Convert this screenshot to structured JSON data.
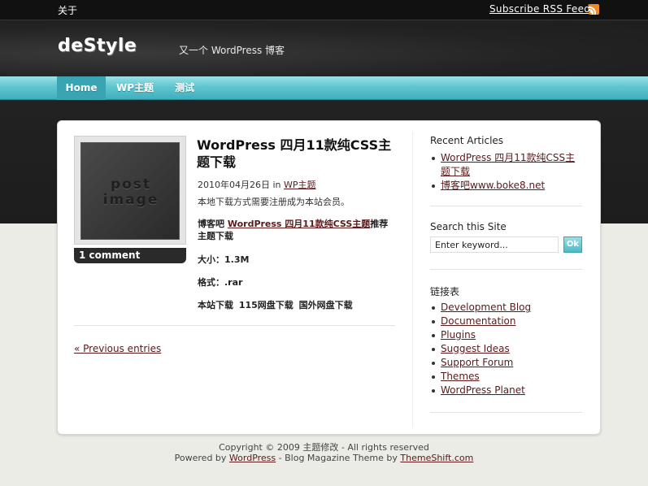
{
  "topbar": {
    "about_label": "关于",
    "rss_label": "Subscribe RSS Feed",
    "rss_icon": "rss-feed-icon"
  },
  "header": {
    "logo_text": "deStyle",
    "tagline": "又一个 WordPress 博客"
  },
  "nav": {
    "items": [
      "Home",
      "WP主题",
      "测试"
    ],
    "active": "Home",
    "accent_color": "#5fc6d0"
  },
  "post": {
    "thumbnail_text_line1": "post",
    "thumbnail_text_line2": "image",
    "comments_label": "1 comment",
    "title": "WordPress 四月11款纯CSS主题下载",
    "date": "2010年04月26日",
    "in_word": "in",
    "category": "WP主题",
    "p1": "本地下载方式需要注册成为本站会员。",
    "p2_prefix": "博客吧 ",
    "p2_link": "WordPress 四月11款纯CSS主题",
    "p2_suffix": "推荐主题下载",
    "size_line": "大小：1.3M",
    "format_line": "格式：.rar",
    "downloads_line": "本站下载  115网盘下载  国外网盘下载",
    "prev_entries": "« Previous entries"
  },
  "sidebar": {
    "recent_title": "Recent Articles",
    "recent_items": [
      "WordPress 四月11款纯CSS主题下载",
      "博客吧www.boke8.net"
    ],
    "search_title": "Search this Site",
    "search_value": "Enter keyword...",
    "search_button": "Ok",
    "links_title": "链接表",
    "links": [
      "Development Blog",
      "Documentation",
      "Plugins",
      "Suggest Ideas",
      "Support Forum",
      "Themes",
      "WordPress Planet"
    ]
  },
  "footer": {
    "copyright": "Copyright © 2009 主题修改 - All rights reserved",
    "powered_prefix": "Powered by ",
    "powered_link": "WordPress",
    "powered_middle": " - Blog Magazine Theme by ",
    "theme_link": "ThemeShift.com"
  }
}
